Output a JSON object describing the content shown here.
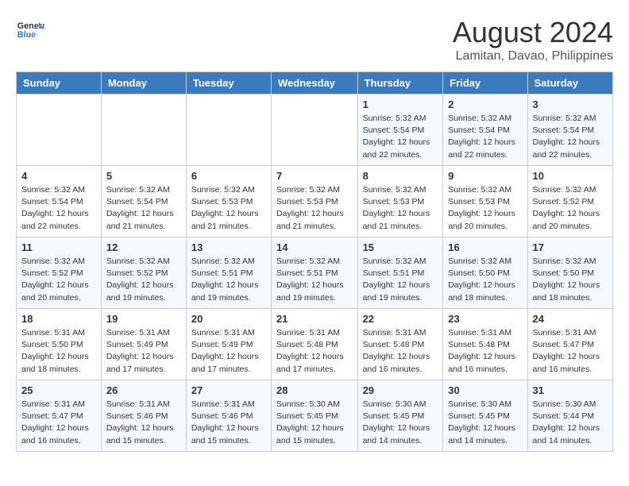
{
  "logo": {
    "line1": "General",
    "line2": "Blue"
  },
  "title": "August 2024",
  "location": "Lamitan, Davao, Philippines",
  "weekdays": [
    "Sunday",
    "Monday",
    "Tuesday",
    "Wednesday",
    "Thursday",
    "Friday",
    "Saturday"
  ],
  "weeks": [
    [
      {
        "day": "",
        "info": ""
      },
      {
        "day": "",
        "info": ""
      },
      {
        "day": "",
        "info": ""
      },
      {
        "day": "",
        "info": ""
      },
      {
        "day": "1",
        "info": "Sunrise: 5:32 AM\nSunset: 5:54 PM\nDaylight: 12 hours\nand 22 minutes."
      },
      {
        "day": "2",
        "info": "Sunrise: 5:32 AM\nSunset: 5:54 PM\nDaylight: 12 hours\nand 22 minutes."
      },
      {
        "day": "3",
        "info": "Sunrise: 5:32 AM\nSunset: 5:54 PM\nDaylight: 12 hours\nand 22 minutes."
      }
    ],
    [
      {
        "day": "4",
        "info": "Sunrise: 5:32 AM\nSunset: 5:54 PM\nDaylight: 12 hours\nand 22 minutes."
      },
      {
        "day": "5",
        "info": "Sunrise: 5:32 AM\nSunset: 5:54 PM\nDaylight: 12 hours\nand 21 minutes."
      },
      {
        "day": "6",
        "info": "Sunrise: 5:32 AM\nSunset: 5:53 PM\nDaylight: 12 hours\nand 21 minutes."
      },
      {
        "day": "7",
        "info": "Sunrise: 5:32 AM\nSunset: 5:53 PM\nDaylight: 12 hours\nand 21 minutes."
      },
      {
        "day": "8",
        "info": "Sunrise: 5:32 AM\nSunset: 5:53 PM\nDaylight: 12 hours\nand 21 minutes."
      },
      {
        "day": "9",
        "info": "Sunrise: 5:32 AM\nSunset: 5:53 PM\nDaylight: 12 hours\nand 20 minutes."
      },
      {
        "day": "10",
        "info": "Sunrise: 5:32 AM\nSunset: 5:52 PM\nDaylight: 12 hours\nand 20 minutes."
      }
    ],
    [
      {
        "day": "11",
        "info": "Sunrise: 5:32 AM\nSunset: 5:52 PM\nDaylight: 12 hours\nand 20 minutes."
      },
      {
        "day": "12",
        "info": "Sunrise: 5:32 AM\nSunset: 5:52 PM\nDaylight: 12 hours\nand 19 minutes."
      },
      {
        "day": "13",
        "info": "Sunrise: 5:32 AM\nSunset: 5:51 PM\nDaylight: 12 hours\nand 19 minutes."
      },
      {
        "day": "14",
        "info": "Sunrise: 5:32 AM\nSunset: 5:51 PM\nDaylight: 12 hours\nand 19 minutes."
      },
      {
        "day": "15",
        "info": "Sunrise: 5:32 AM\nSunset: 5:51 PM\nDaylight: 12 hours\nand 19 minutes."
      },
      {
        "day": "16",
        "info": "Sunrise: 5:32 AM\nSunset: 5:50 PM\nDaylight: 12 hours\nand 18 minutes."
      },
      {
        "day": "17",
        "info": "Sunrise: 5:32 AM\nSunset: 5:50 PM\nDaylight: 12 hours\nand 18 minutes."
      }
    ],
    [
      {
        "day": "18",
        "info": "Sunrise: 5:31 AM\nSunset: 5:50 PM\nDaylight: 12 hours\nand 18 minutes."
      },
      {
        "day": "19",
        "info": "Sunrise: 5:31 AM\nSunset: 5:49 PM\nDaylight: 12 hours\nand 17 minutes."
      },
      {
        "day": "20",
        "info": "Sunrise: 5:31 AM\nSunset: 5:49 PM\nDaylight: 12 hours\nand 17 minutes."
      },
      {
        "day": "21",
        "info": "Sunrise: 5:31 AM\nSunset: 5:48 PM\nDaylight: 12 hours\nand 17 minutes."
      },
      {
        "day": "22",
        "info": "Sunrise: 5:31 AM\nSunset: 5:48 PM\nDaylight: 12 hours\nand 16 minutes."
      },
      {
        "day": "23",
        "info": "Sunrise: 5:31 AM\nSunset: 5:48 PM\nDaylight: 12 hours\nand 16 minutes."
      },
      {
        "day": "24",
        "info": "Sunrise: 5:31 AM\nSunset: 5:47 PM\nDaylight: 12 hours\nand 16 minutes."
      }
    ],
    [
      {
        "day": "25",
        "info": "Sunrise: 5:31 AM\nSunset: 5:47 PM\nDaylight: 12 hours\nand 16 minutes."
      },
      {
        "day": "26",
        "info": "Sunrise: 5:31 AM\nSunset: 5:46 PM\nDaylight: 12 hours\nand 15 minutes."
      },
      {
        "day": "27",
        "info": "Sunrise: 5:31 AM\nSunset: 5:46 PM\nDaylight: 12 hours\nand 15 minutes."
      },
      {
        "day": "28",
        "info": "Sunrise: 5:30 AM\nSunset: 5:45 PM\nDaylight: 12 hours\nand 15 minutes."
      },
      {
        "day": "29",
        "info": "Sunrise: 5:30 AM\nSunset: 5:45 PM\nDaylight: 12 hours\nand 14 minutes."
      },
      {
        "day": "30",
        "info": "Sunrise: 5:30 AM\nSunset: 5:45 PM\nDaylight: 12 hours\nand 14 minutes."
      },
      {
        "day": "31",
        "info": "Sunrise: 5:30 AM\nSunset: 5:44 PM\nDaylight: 12 hours\nand 14 minutes."
      }
    ]
  ]
}
